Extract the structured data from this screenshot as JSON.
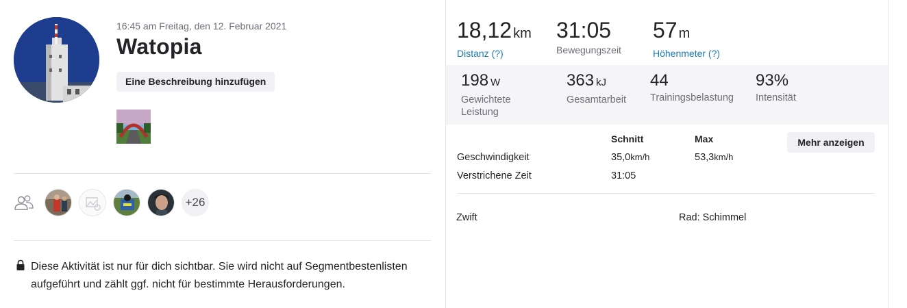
{
  "activity": {
    "datetime": "16:45 am Freitag, den 12. Februar 2021",
    "title": "Watopia",
    "add_description_label": "Eine Beschreibung hinzufügen"
  },
  "group": {
    "more_count": "+26"
  },
  "privacy": {
    "notice": "Diese Aktivität ist nur für dich sichtbar. Sie wird nicht auf Segmentbestenlisten aufgeführt und zählt ggf. nicht für bestimmte Herausforderungen."
  },
  "primary_stats": [
    {
      "value": "18,12",
      "unit": "km",
      "label": "Distanz (?)"
    },
    {
      "value": "31:05",
      "unit": "",
      "label": "Bewegungszeit"
    },
    {
      "value": "57",
      "unit": "m",
      "label": "Höhenmeter (?)"
    }
  ],
  "secondary_stats": [
    {
      "value": "198",
      "unit": "W",
      "label": "Gewichtete Leistung"
    },
    {
      "value": "363",
      "unit": "kJ",
      "label": "Gesamtarbeit"
    },
    {
      "value": "44",
      "unit": "",
      "label": "Trainingsbelastung"
    },
    {
      "value": "93%",
      "unit": "",
      "label": "Intensität"
    }
  ],
  "details_table": {
    "headers": {
      "avg": "Schnitt",
      "max": "Max"
    },
    "rows": [
      {
        "label": "Geschwindigkeit",
        "avg": "35,0",
        "avg_unit": "km/h",
        "max": "53,3",
        "max_unit": "km/h"
      },
      {
        "label": "Verstrichene Zeit",
        "avg": "31:05",
        "avg_unit": "",
        "max": "",
        "max_unit": ""
      }
    ],
    "show_more_label": "Mehr anzeigen"
  },
  "device": {
    "app": "Zwift",
    "bike": "Rad: Schimmel"
  },
  "colors": {
    "link": "#1a7bb5",
    "muted": "#6d6d78",
    "panel_bg": "#f5f5f8",
    "button_bg": "#f0f0f5"
  }
}
